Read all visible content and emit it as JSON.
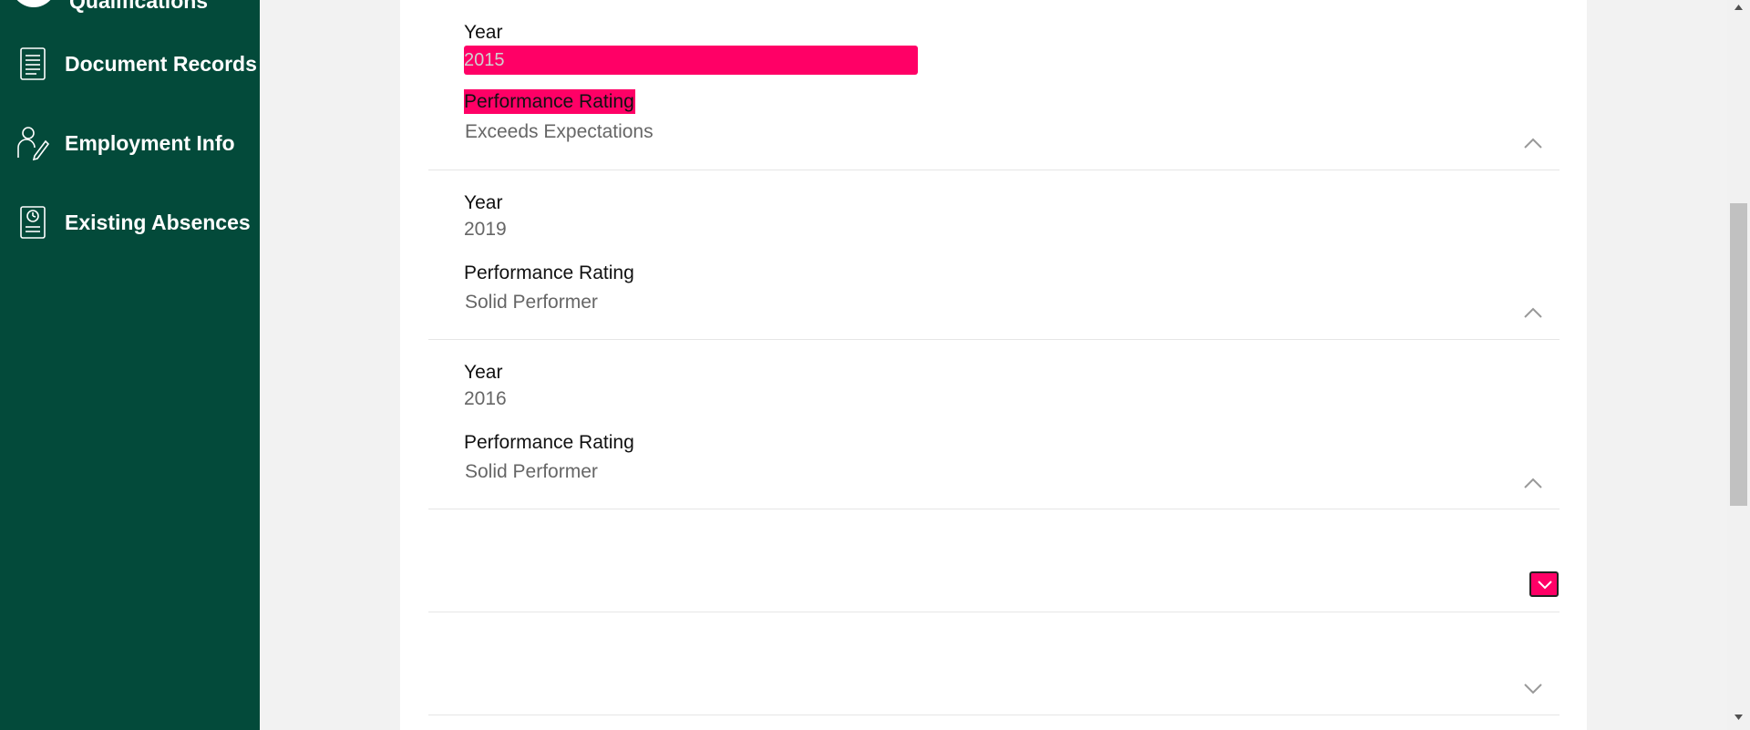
{
  "sidebar": {
    "partial_item_label": "Qualifications",
    "items": [
      {
        "label": "Document Records",
        "icon": "document-icon"
      },
      {
        "label": "Employment Info",
        "icon": "employment-icon"
      },
      {
        "label": "Existing Absences",
        "icon": "absences-icon"
      }
    ]
  },
  "records": [
    {
      "year_label": "Year",
      "year": "2015",
      "rating_label": "Performance Rating",
      "rating": "Exceeds Expectations"
    },
    {
      "year_label": "Year",
      "year": "2019",
      "rating_label": "Performance Rating",
      "rating": "Solid Performer"
    },
    {
      "year_label": "Year",
      "year": "2016",
      "rating_label": "Performance Rating",
      "rating": "Solid Performer"
    }
  ],
  "colors": {
    "sidebar_bg": "#034a3a",
    "highlight": "#ff0066",
    "page_bg": "#f2f2f2"
  }
}
